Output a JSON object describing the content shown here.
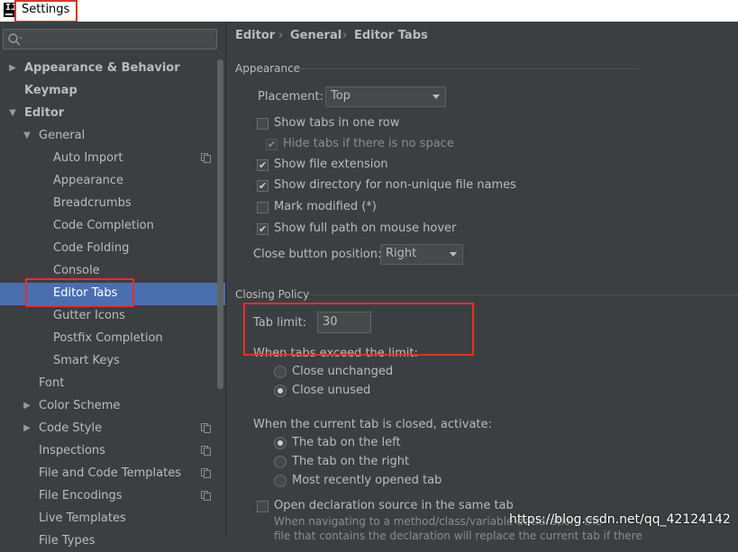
{
  "window": {
    "title": "Settings"
  },
  "sidebar": {
    "items": [
      {
        "label": "Appearance & Behavior"
      },
      {
        "label": "Keymap"
      },
      {
        "label": "Editor"
      },
      {
        "label": "General"
      },
      {
        "label": "Auto Import"
      },
      {
        "label": "Appearance"
      },
      {
        "label": "Breadcrumbs"
      },
      {
        "label": "Code Completion"
      },
      {
        "label": "Code Folding"
      },
      {
        "label": "Console"
      },
      {
        "label": "Editor Tabs"
      },
      {
        "label": "Gutter Icons"
      },
      {
        "label": "Postfix Completion"
      },
      {
        "label": "Smart Keys"
      },
      {
        "label": "Font"
      },
      {
        "label": "Color Scheme"
      },
      {
        "label": "Code Style"
      },
      {
        "label": "Inspections"
      },
      {
        "label": "File and Code Templates"
      },
      {
        "label": "File Encodings"
      },
      {
        "label": "Live Templates"
      },
      {
        "label": "File Types"
      }
    ]
  },
  "breadcrumb": [
    "Editor",
    "General",
    "Editor Tabs"
  ],
  "appearance": {
    "title": "Appearance",
    "placement_label": "Placement:",
    "placement_value": "Top",
    "show_tabs_one_row": "Show tabs in one row",
    "hide_tabs": "Hide tabs if there is no space",
    "show_file_ext": "Show file extension",
    "show_dir": "Show directory for non-unique file names",
    "mark_modified": "Mark modified (*)",
    "show_full_path": "Show full path on mouse hover",
    "close_btn_label": "Close button position:",
    "close_btn_value": "Right"
  },
  "closing": {
    "title": "Closing Policy",
    "tab_limit_label": "Tab limit:",
    "tab_limit_value": "30",
    "exceed_label": "When tabs exceed the limit:",
    "close_unchanged": "Close unchanged",
    "close_unused": "Close unused",
    "activate_label": "When the current tab is closed, activate:",
    "left": "The tab on the left",
    "right": "The tab on the right",
    "recent": "Most recently opened tab",
    "open_decl": "Open declaration source in the same tab",
    "open_decl_hint1": "When navigating to a method/class/variable declaration, the",
    "open_decl_hint2": "file that contains the declaration will replace the current tab if there"
  },
  "watermark": "https://blog.csdn.net/qq_42124142",
  "colors": {
    "selection": "#4b6eaf",
    "highlight_box": "#e0312e",
    "background": "#3c3f41"
  }
}
